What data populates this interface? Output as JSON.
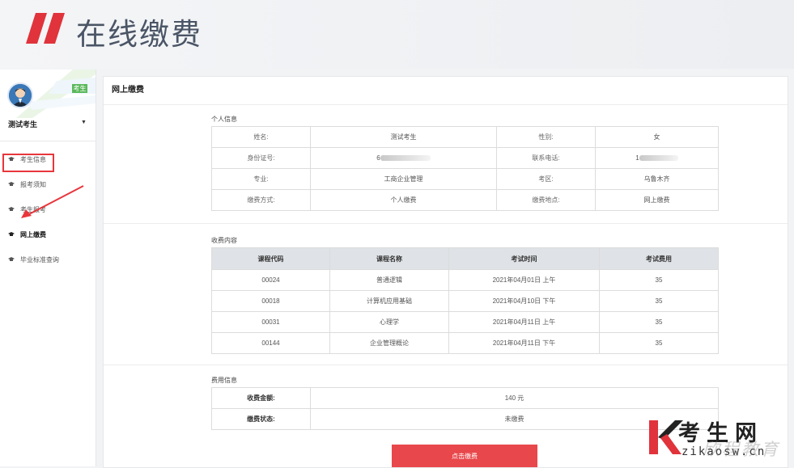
{
  "header": {
    "title": "在线缴费"
  },
  "sidebar": {
    "badge": "考生",
    "user_name": "测试考生",
    "dropdown_symbol": "▼",
    "items": [
      {
        "label": "考生信息",
        "active": false
      },
      {
        "label": "报考须知",
        "active": false
      },
      {
        "label": "考生报考",
        "active": false
      },
      {
        "label": "网上缴费",
        "active": true
      },
      {
        "label": "毕业标准查询",
        "active": false
      }
    ]
  },
  "panel": {
    "title": "网上缴费",
    "personal": {
      "title": "个人信息",
      "rows": [
        {
          "l1": "姓名:",
          "v1": "测试考生",
          "l2": "性别:",
          "v2": "女"
        },
        {
          "l1": "身份证号:",
          "v1": "6",
          "l2": "联系电话:",
          "v2": "1"
        },
        {
          "l1": "专业:",
          "v1": "工商企业管理",
          "l2": "考区:",
          "v2": "乌鲁木齐"
        },
        {
          "l1": "缴费方式:",
          "v1": "个人缴费",
          "l2": "缴费地点:",
          "v2": "网上缴费"
        }
      ]
    },
    "fees": {
      "title": "收费内容",
      "headers": [
        "课程代码",
        "课程名称",
        "考试时间",
        "考试费用"
      ],
      "rows": [
        [
          "00024",
          "普通逻辑",
          "2021年04月01日 上午",
          "35"
        ],
        [
          "00018",
          "计算机应用基础",
          "2021年04月10日 下午",
          "35"
        ],
        [
          "00031",
          "心理学",
          "2021年04月11日 上午",
          "35"
        ],
        [
          "00144",
          "企业管理概论",
          "2021年04月11日 下午",
          "35"
        ]
      ]
    },
    "summary": {
      "title": "费用信息",
      "amount_label": "收费金额:",
      "amount_value": "140 元",
      "status_label": "缴费状态:",
      "status_value": "未缴费"
    },
    "pay_button": "点击缴费"
  },
  "watermark": {
    "cn": "考生网",
    "en": "zikaosw.cn",
    "ghost": "欣程教育"
  },
  "colors": {
    "accent": "#e8474b",
    "title": "#4a5566",
    "badge": "#5ab85a"
  }
}
